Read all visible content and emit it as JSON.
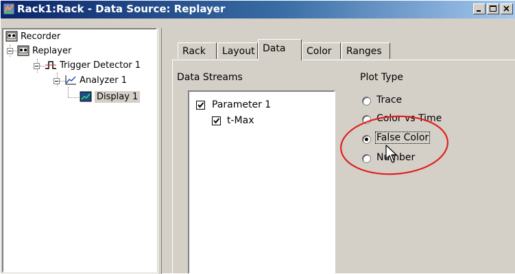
{
  "window": {
    "title": "Rack1:Rack - Data Source: Replayer"
  },
  "tree": {
    "items": [
      {
        "label": "Recorder",
        "icon": "recorder-icon"
      },
      {
        "label": "Replayer",
        "icon": "replayer-icon"
      },
      {
        "label": "Trigger Detector 1",
        "icon": "trigger-detector-icon"
      },
      {
        "label": "Analyzer 1",
        "icon": "analyzer-icon"
      },
      {
        "label": "Display 1",
        "icon": "display-icon",
        "selected": true
      }
    ]
  },
  "tabs": [
    {
      "label": "Rack"
    },
    {
      "label": "Layout"
    },
    {
      "label": "Data",
      "active": true
    },
    {
      "label": "Color"
    },
    {
      "label": "Ranges"
    }
  ],
  "data_panel": {
    "streams_label": "Data Streams",
    "streams": [
      {
        "label": "Parameter 1",
        "checked": true
      },
      {
        "label": "t-Max",
        "checked": true
      }
    ],
    "plot_type_label": "Plot Type",
    "plot_types": [
      {
        "label": "Trace",
        "checked": false
      },
      {
        "label": "Color vs Time",
        "checked": false
      },
      {
        "label": "False Color",
        "checked": true
      },
      {
        "label": "Number",
        "checked": false
      }
    ]
  },
  "annotation": {
    "ellipse_color": "#e02020"
  },
  "colors": {
    "title_start": "#0a246a",
    "title_end": "#a6caf0",
    "face": "#d4d0c8"
  }
}
